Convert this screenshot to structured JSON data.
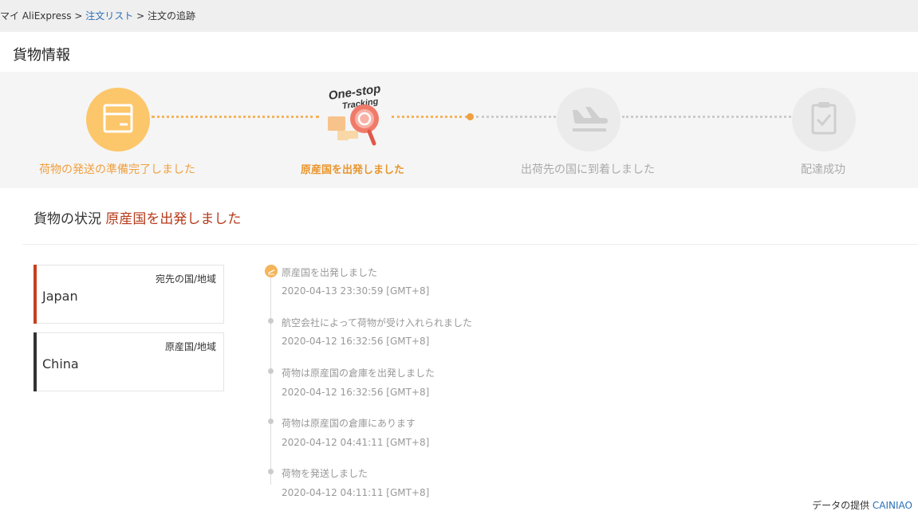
{
  "breadcrumb": {
    "home": "マイ AliExpress",
    "sep1": " > ",
    "orders": "注文リスト",
    "sep2": " > ",
    "current": "注文の追跡"
  },
  "page_title": "貨物情報",
  "tracker": {
    "promo": {
      "line1": "One-stop",
      "line2": "Tracking"
    },
    "steps": [
      {
        "label": "荷物の発送の準備完了しました",
        "state": "done"
      },
      {
        "label": "原産国を出発しました",
        "state": "current"
      },
      {
        "label": "出荷先の国に到着しました",
        "state": "pending"
      },
      {
        "label": "配達成功",
        "state": "pending"
      }
    ],
    "icons": [
      "box-icon",
      "one-stop-tracking-icon",
      "airplane-landing-icon",
      "clipboard-check-icon"
    ],
    "progress_fraction": 0.5
  },
  "status": {
    "label": "貨物の状況",
    "value": "原産国を出発しました"
  },
  "destination": {
    "label": "宛先の国/地域",
    "value": "Japan"
  },
  "origin": {
    "label": "原産国/地域",
    "value": "China"
  },
  "events": [
    {
      "text": "原産国を出発しました",
      "time": "2020-04-13 23:30:59 [GMT+8]"
    },
    {
      "text": "航空会社によって荷物が受け入れられました",
      "time": "2020-04-12 16:32:56 [GMT+8]"
    },
    {
      "text": "荷物は原産国の倉庫を出発しました",
      "time": "2020-04-12 16:32:56 [GMT+8]"
    },
    {
      "text": "荷物は原産国の倉庫にあります",
      "time": "2020-04-12 04:41:11 [GMT+8]"
    },
    {
      "text": "荷物を発送しました",
      "time": "2020-04-12 04:11:11 [GMT+8]"
    }
  ],
  "credit": {
    "label": "データの提供",
    "brand": "CAINIAO"
  },
  "colors": {
    "accent": "#f5b45a",
    "status_text": "#b53a1a",
    "link": "#2a6fb7",
    "destination_bar": "#c7401f",
    "origin_bar": "#333333",
    "pending": "#cccccc"
  }
}
